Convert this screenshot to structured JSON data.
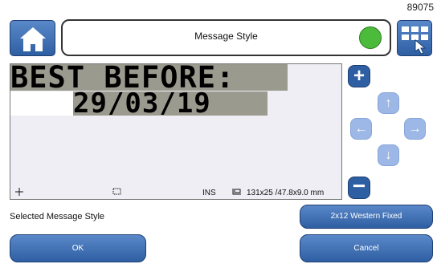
{
  "serial": "89075",
  "header": {
    "title": "Message Style"
  },
  "editor": {
    "line1": "BEST BEFORE:",
    "line2": "29/03/19",
    "status": {
      "insert_mode": "INS",
      "size": "131x25 /47.8x9.0 mm"
    }
  },
  "footer": {
    "selected_label": "Selected Message Style",
    "style_value": "2x12 Western Fixed",
    "ok_label": "OK",
    "cancel_label": "Cancel"
  },
  "icons": {
    "home": "home-icon",
    "keyboard": "keyboard-icon",
    "status": "status-led",
    "plus": "plus-icon",
    "minus": "minus-icon",
    "up": "arrow-up-icon",
    "down": "arrow-down-icon",
    "left": "arrow-left-icon",
    "right": "arrow-right-icon"
  },
  "colors": {
    "accent": "#2f5fa3",
    "status_ok": "#4cbb3c",
    "arrow": "#9db8e6",
    "highlight": "#9a9a8f"
  }
}
